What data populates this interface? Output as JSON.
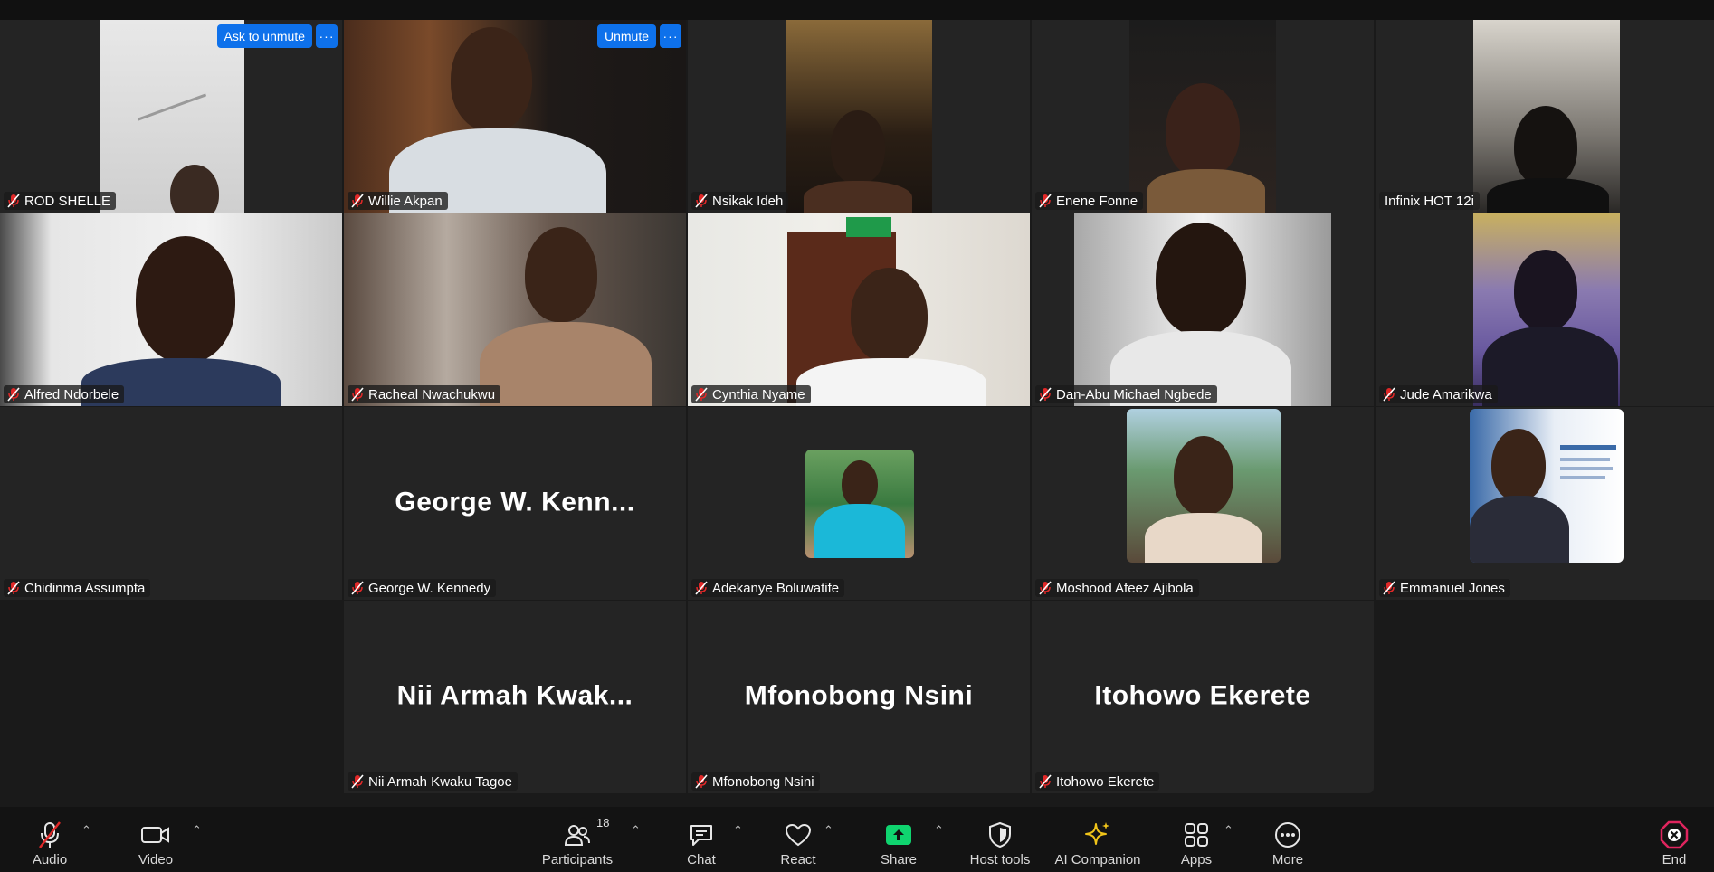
{
  "participants_grid": {
    "row1": [
      {
        "name": "ROD SHELLE"
      },
      {
        "name": "Willie Akpan"
      },
      {
        "name": "Nsikak Ideh"
      },
      {
        "name": "Enene Fonne"
      },
      {
        "name": "Infinix HOT 12i"
      }
    ],
    "row2": [
      {
        "name": "Alfred Ndorbele"
      },
      {
        "name": "Racheal Nwachukwu"
      },
      {
        "name": "Cynthia Nyame"
      },
      {
        "name": "Dan-Abu Michael Ngbede"
      },
      {
        "name": "Jude Amarikwa"
      }
    ],
    "row3": [
      {
        "name": "Chidinma Assumpta"
      },
      {
        "name": "George W. Kennedy",
        "display": "George W. Kenn..."
      },
      {
        "name": "Adekanye Boluwatife"
      },
      {
        "name": "Moshood Afeez Ajibola"
      },
      {
        "name": "Emmanuel Jones"
      }
    ],
    "row4": [
      {
        "name": "Nii Armah Kwaku Tagoe",
        "display": "Nii Armah Kwak..."
      },
      {
        "name": "Mfonobong Nsini",
        "display": "Mfonobong Nsini"
      },
      {
        "name": "Itohowo Ekerete",
        "display": "Itohowo Ekerete"
      }
    ]
  },
  "hover_actions": {
    "ask_to_unmute": "Ask to unmute",
    "unmute": "Unmute",
    "more": "···"
  },
  "toolbar": {
    "audio": "Audio",
    "video": "Video",
    "participants": "Participants",
    "participants_count": "18",
    "chat": "Chat",
    "react": "React",
    "share": "Share",
    "host_tools": "Host tools",
    "ai_companion": "AI Companion",
    "apps": "Apps",
    "more": "More",
    "end": "End"
  },
  "colors": {
    "active_speaker": "#23d18b",
    "button_blue": "#0e71eb",
    "share_green": "#0fd46f",
    "mute_red": "#e02828",
    "ai_gold": "#f0c419",
    "end_red": "#e0245e"
  }
}
